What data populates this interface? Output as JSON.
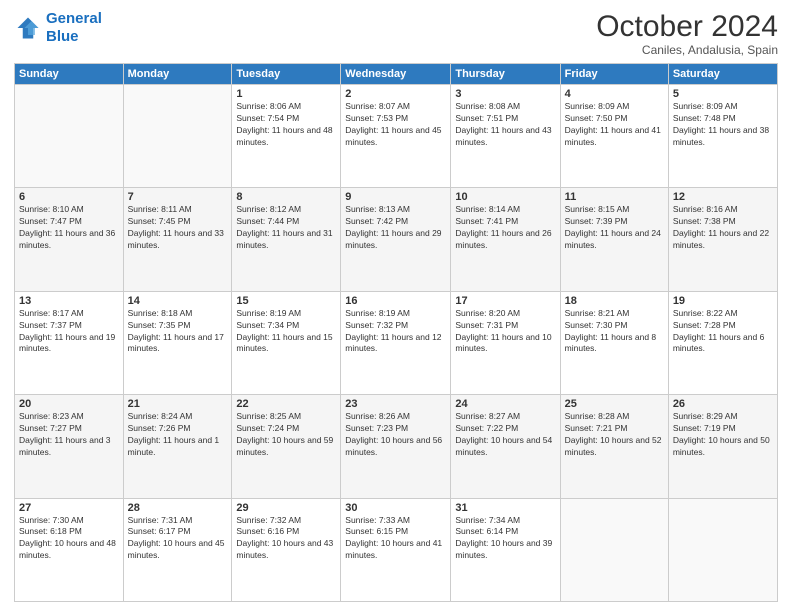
{
  "logo": {
    "line1": "General",
    "line2": "Blue"
  },
  "title": "October 2024",
  "subtitle": "Caniles, Andalusia, Spain",
  "weekdays": [
    "Sunday",
    "Monday",
    "Tuesday",
    "Wednesday",
    "Thursday",
    "Friday",
    "Saturday"
  ],
  "weeks": [
    [
      {
        "day": "",
        "info": ""
      },
      {
        "day": "",
        "info": ""
      },
      {
        "day": "1",
        "info": "Sunrise: 8:06 AM\nSunset: 7:54 PM\nDaylight: 11 hours and 48 minutes."
      },
      {
        "day": "2",
        "info": "Sunrise: 8:07 AM\nSunset: 7:53 PM\nDaylight: 11 hours and 45 minutes."
      },
      {
        "day": "3",
        "info": "Sunrise: 8:08 AM\nSunset: 7:51 PM\nDaylight: 11 hours and 43 minutes."
      },
      {
        "day": "4",
        "info": "Sunrise: 8:09 AM\nSunset: 7:50 PM\nDaylight: 11 hours and 41 minutes."
      },
      {
        "day": "5",
        "info": "Sunrise: 8:09 AM\nSunset: 7:48 PM\nDaylight: 11 hours and 38 minutes."
      }
    ],
    [
      {
        "day": "6",
        "info": "Sunrise: 8:10 AM\nSunset: 7:47 PM\nDaylight: 11 hours and 36 minutes."
      },
      {
        "day": "7",
        "info": "Sunrise: 8:11 AM\nSunset: 7:45 PM\nDaylight: 11 hours and 33 minutes."
      },
      {
        "day": "8",
        "info": "Sunrise: 8:12 AM\nSunset: 7:44 PM\nDaylight: 11 hours and 31 minutes."
      },
      {
        "day": "9",
        "info": "Sunrise: 8:13 AM\nSunset: 7:42 PM\nDaylight: 11 hours and 29 minutes."
      },
      {
        "day": "10",
        "info": "Sunrise: 8:14 AM\nSunset: 7:41 PM\nDaylight: 11 hours and 26 minutes."
      },
      {
        "day": "11",
        "info": "Sunrise: 8:15 AM\nSunset: 7:39 PM\nDaylight: 11 hours and 24 minutes."
      },
      {
        "day": "12",
        "info": "Sunrise: 8:16 AM\nSunset: 7:38 PM\nDaylight: 11 hours and 22 minutes."
      }
    ],
    [
      {
        "day": "13",
        "info": "Sunrise: 8:17 AM\nSunset: 7:37 PM\nDaylight: 11 hours and 19 minutes."
      },
      {
        "day": "14",
        "info": "Sunrise: 8:18 AM\nSunset: 7:35 PM\nDaylight: 11 hours and 17 minutes."
      },
      {
        "day": "15",
        "info": "Sunrise: 8:19 AM\nSunset: 7:34 PM\nDaylight: 11 hours and 15 minutes."
      },
      {
        "day": "16",
        "info": "Sunrise: 8:19 AM\nSunset: 7:32 PM\nDaylight: 11 hours and 12 minutes."
      },
      {
        "day": "17",
        "info": "Sunrise: 8:20 AM\nSunset: 7:31 PM\nDaylight: 11 hours and 10 minutes."
      },
      {
        "day": "18",
        "info": "Sunrise: 8:21 AM\nSunset: 7:30 PM\nDaylight: 11 hours and 8 minutes."
      },
      {
        "day": "19",
        "info": "Sunrise: 8:22 AM\nSunset: 7:28 PM\nDaylight: 11 hours and 6 minutes."
      }
    ],
    [
      {
        "day": "20",
        "info": "Sunrise: 8:23 AM\nSunset: 7:27 PM\nDaylight: 11 hours and 3 minutes."
      },
      {
        "day": "21",
        "info": "Sunrise: 8:24 AM\nSunset: 7:26 PM\nDaylight: 11 hours and 1 minute."
      },
      {
        "day": "22",
        "info": "Sunrise: 8:25 AM\nSunset: 7:24 PM\nDaylight: 10 hours and 59 minutes."
      },
      {
        "day": "23",
        "info": "Sunrise: 8:26 AM\nSunset: 7:23 PM\nDaylight: 10 hours and 56 minutes."
      },
      {
        "day": "24",
        "info": "Sunrise: 8:27 AM\nSunset: 7:22 PM\nDaylight: 10 hours and 54 minutes."
      },
      {
        "day": "25",
        "info": "Sunrise: 8:28 AM\nSunset: 7:21 PM\nDaylight: 10 hours and 52 minutes."
      },
      {
        "day": "26",
        "info": "Sunrise: 8:29 AM\nSunset: 7:19 PM\nDaylight: 10 hours and 50 minutes."
      }
    ],
    [
      {
        "day": "27",
        "info": "Sunrise: 7:30 AM\nSunset: 6:18 PM\nDaylight: 10 hours and 48 minutes."
      },
      {
        "day": "28",
        "info": "Sunrise: 7:31 AM\nSunset: 6:17 PM\nDaylight: 10 hours and 45 minutes."
      },
      {
        "day": "29",
        "info": "Sunrise: 7:32 AM\nSunset: 6:16 PM\nDaylight: 10 hours and 43 minutes."
      },
      {
        "day": "30",
        "info": "Sunrise: 7:33 AM\nSunset: 6:15 PM\nDaylight: 10 hours and 41 minutes."
      },
      {
        "day": "31",
        "info": "Sunrise: 7:34 AM\nSunset: 6:14 PM\nDaylight: 10 hours and 39 minutes."
      },
      {
        "day": "",
        "info": ""
      },
      {
        "day": "",
        "info": ""
      }
    ]
  ]
}
